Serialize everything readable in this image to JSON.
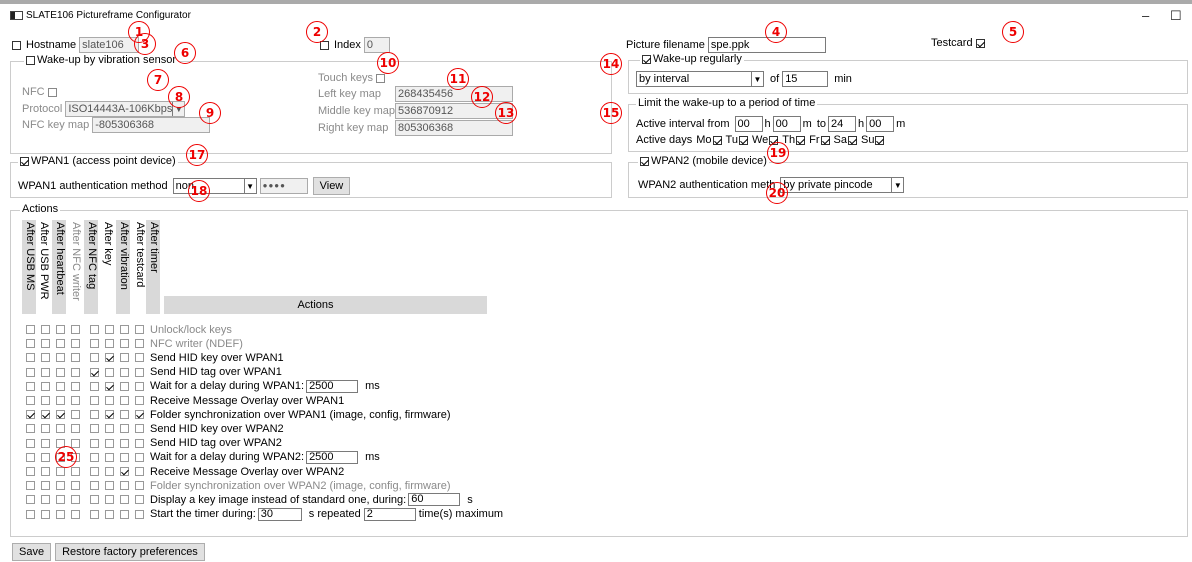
{
  "window": {
    "title": "SLATE106 Pictureframe Configurator",
    "minimize": "–",
    "maximize": "☐"
  },
  "top": {
    "hostname_label": "Hostname",
    "hostname_value": "slate106",
    "index_label": "Index",
    "index_value": "0",
    "picture_label": "Picture filename",
    "picture_value": "spe.ppk",
    "testcard_label": "Testcard"
  },
  "vibration": {
    "legend": "Wake-up by vibration sensor",
    "nfc_label": "NFC",
    "protocol_label": "Protocol",
    "protocol_value": "ISO14443A-106Kbps",
    "nfc_keymap_label": "NFC key map",
    "nfc_keymap_value": "-805306368",
    "touch_keys_label": "Touch keys",
    "left_label": "Left key map",
    "left_value": "268435456",
    "middle_label": "Middle key map",
    "middle_value": "536870912",
    "right_label": "Right key map",
    "right_value": "805306368"
  },
  "wake_regular": {
    "legend": "Wake-up regularly",
    "mode_value": "by interval",
    "of_label": "of",
    "interval_value": "15",
    "unit": "min"
  },
  "limit": {
    "legend": "Limit the wake-up to a period of time",
    "active_label": "Active interval from",
    "from_h": "00",
    "h1": "h",
    "from_m": "00",
    "m1": "m",
    "to_label": "to",
    "to_h": "24",
    "h2": "h",
    "to_m": "00",
    "m2": "m",
    "days_label": "Active days",
    "days": [
      "Mo",
      "Tu",
      "We",
      "Th",
      "Fr",
      "Sa",
      "Su"
    ]
  },
  "wpan1": {
    "legend": "WPAN1 (access point device)",
    "auth_label": "WPAN1 authentication method",
    "auth_value": "non",
    "pass_value": "●●●●",
    "view_label": "View"
  },
  "wpan2": {
    "legend": "WPAN2 (mobile device)",
    "auth_label": "WPAN2 authentication meth",
    "auth_value": "by private pincode"
  },
  "actions": {
    "legend": "Actions",
    "header": "Actions",
    "columns": [
      "After USB MS",
      "After USB PWR",
      "After heartbeat",
      "After NFC writer",
      "After NFC tag",
      "After key",
      "After vibration",
      "After testcard",
      "After timer"
    ],
    "rows": [
      {
        "label": "Unlock/lock keys",
        "gray": true,
        "checks": [
          0,
          0,
          0,
          0,
          0,
          0,
          0,
          0
        ]
      },
      {
        "label": "NFC writer (NDEF)",
        "gray": true,
        "checks": [
          0,
          0,
          0,
          0,
          0,
          0,
          0,
          0
        ]
      },
      {
        "label": "Send HID key over WPAN1",
        "gray": false,
        "checks": [
          0,
          0,
          0,
          0,
          0,
          1,
          0,
          0
        ]
      },
      {
        "label": "Send HID tag over WPAN1",
        "gray": false,
        "checks": [
          0,
          0,
          0,
          0,
          1,
          0,
          0,
          0
        ]
      },
      {
        "label": "Wait for a delay during WPAN1:",
        "gray": false,
        "checks": [
          0,
          0,
          0,
          0,
          0,
          1,
          0,
          0
        ],
        "input": "2500",
        "suffix": "ms"
      },
      {
        "label": "Receive Message Overlay over WPAN1",
        "gray": false,
        "checks": [
          0,
          0,
          0,
          0,
          0,
          0,
          0,
          0
        ]
      },
      {
        "label": "Folder synchronization over WPAN1 (image, config, firmware)",
        "gray": false,
        "checks": [
          1,
          1,
          1,
          0,
          0,
          1,
          0,
          1
        ]
      },
      {
        "label": "Send HID key over WPAN2",
        "gray": false,
        "checks": [
          0,
          0,
          0,
          0,
          0,
          0,
          0,
          0
        ]
      },
      {
        "label": "Send HID tag over WPAN2",
        "gray": false,
        "checks": [
          0,
          0,
          0,
          0,
          0,
          0,
          0,
          0
        ]
      },
      {
        "label": "Wait for a delay during WPAN2:",
        "gray": false,
        "checks": [
          0,
          0,
          0,
          0,
          0,
          0,
          0,
          0
        ],
        "input": "2500",
        "suffix": "ms"
      },
      {
        "label": "Receive Message Overlay over WPAN2",
        "gray": false,
        "checks": [
          0,
          0,
          0,
          0,
          0,
          0,
          1,
          0
        ]
      },
      {
        "label": "Folder synchronization over WPAN2 (image, config, firmware)",
        "gray": true,
        "checks": [
          0,
          0,
          0,
          0,
          0,
          0,
          0,
          0
        ]
      },
      {
        "label": "Display a key image instead of standard one, during:",
        "gray": false,
        "checks": [
          0,
          0,
          0,
          0,
          0,
          0,
          0,
          0
        ],
        "input": "60",
        "suffix": "s"
      },
      {
        "label": "Start the timer during:",
        "gray": false,
        "checks": [
          0,
          0,
          0,
          0,
          0,
          0,
          0,
          0
        ],
        "input": "30",
        "suffix": "s repeated",
        "input2": "2",
        "suffix2": "time(s) maximum"
      }
    ]
  },
  "footer": {
    "save_label": "Save",
    "restore_label": "Restore factory preferences"
  },
  "badges": [
    "1",
    "2",
    "3",
    "4",
    "5",
    "6",
    "7",
    "8",
    "9",
    "10",
    "11",
    "12",
    "13",
    "14",
    "15",
    "17",
    "18",
    "19",
    "20",
    "25"
  ]
}
